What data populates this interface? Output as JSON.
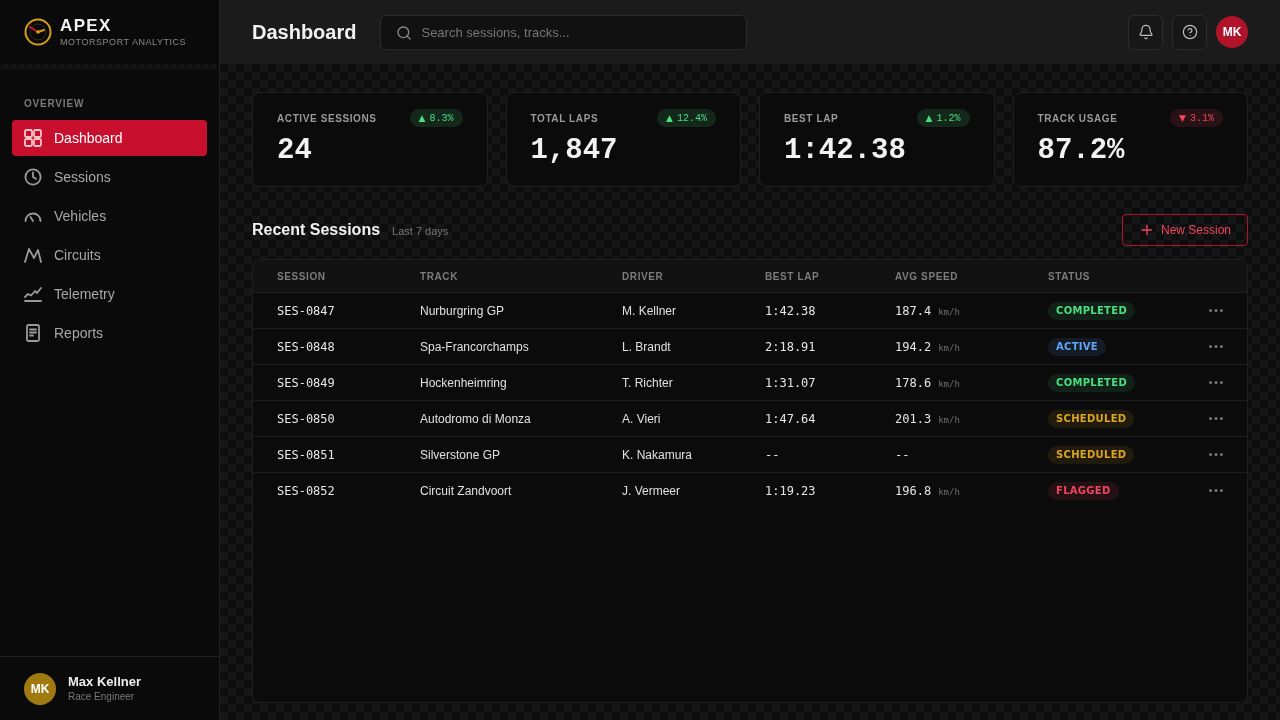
{
  "brand": {
    "name": "APEX",
    "tagline": "MOTORSPORT ANALYTICS"
  },
  "sidebar": {
    "section": "OVERVIEW",
    "items": [
      {
        "label": "Dashboard",
        "selected": true
      },
      {
        "label": "Sessions",
        "selected": false
      },
      {
        "label": "Vehicles",
        "selected": false
      },
      {
        "label": "Circuits",
        "selected": false
      },
      {
        "label": "Telemetry",
        "selected": false
      },
      {
        "label": "Reports",
        "selected": false
      }
    ]
  },
  "user": {
    "initials": "MK",
    "name": "Max Kellner",
    "role": "Race Engineer"
  },
  "header": {
    "title": "Dashboard",
    "search": {
      "placeholder": "Search sessions, tracks..."
    },
    "avatar": "MK"
  },
  "stats": [
    {
      "label": "ACTIVE SESSIONS",
      "value": "24",
      "arrow": "▲",
      "change": "8.3%",
      "color": "#4ade80"
    },
    {
      "label": "TOTAL LAPS",
      "value": "1,847",
      "arrow": "▲",
      "change": "12.4%",
      "color": "#4ade80"
    },
    {
      "label": "BEST LAP",
      "value": "1:42.38",
      "arrow": "▲",
      "change": "1.2%",
      "color": "#4ade80"
    },
    {
      "label": "TRACK USAGE",
      "value": "87.2%",
      "arrow": "▼",
      "change": "3.1%",
      "color": "#f0455e"
    }
  ],
  "sessions": {
    "title": "Recent Sessions",
    "subtitle": "Last 7 days",
    "button": "New Session",
    "columns": [
      "SESSION",
      "TRACK",
      "DRIVER",
      "BEST LAP",
      "AVG SPEED",
      "STATUS"
    ],
    "rows": [
      {
        "session": "SES-0847",
        "track": "Nurburgring GP",
        "driver": "M. Kellner",
        "best_lap": "1:42.38",
        "avg_speed": "187.4",
        "unit": "km/h",
        "status": "COMPLETED",
        "color": "#4ade80"
      },
      {
        "session": "SES-0848",
        "track": "Spa-Francorchamps",
        "driver": "L. Brandt",
        "best_lap": "2:18.91",
        "avg_speed": "194.2",
        "unit": "km/h",
        "status": "ACTIVE",
        "color": "#60a5fa"
      },
      {
        "session": "SES-0849",
        "track": "Hockenheimring",
        "driver": "T. Richter",
        "best_lap": "1:31.07",
        "avg_speed": "178.6",
        "unit": "km/h",
        "status": "COMPLETED",
        "color": "#4ade80"
      },
      {
        "session": "SES-0850",
        "track": "Autodromo di Monza",
        "driver": "A. Vieri",
        "best_lap": "1:47.64",
        "avg_speed": "201.3",
        "unit": "km/h",
        "status": "SCHEDULED",
        "color": "#d9a521"
      },
      {
        "session": "SES-0851",
        "track": "Silverstone GP",
        "driver": "K. Nakamura",
        "best_lap": "--",
        "avg_speed": "--",
        "status": "SCHEDULED",
        "color": "#d9a521"
      },
      {
        "session": "SES-0852",
        "track": "Circuit Zandvoort",
        "driver": "J. Vermeer",
        "best_lap": "1:19.23",
        "avg_speed": "196.8",
        "unit": "km/h",
        "status": "FLAGGED",
        "color": "#f0455e"
      }
    ]
  }
}
